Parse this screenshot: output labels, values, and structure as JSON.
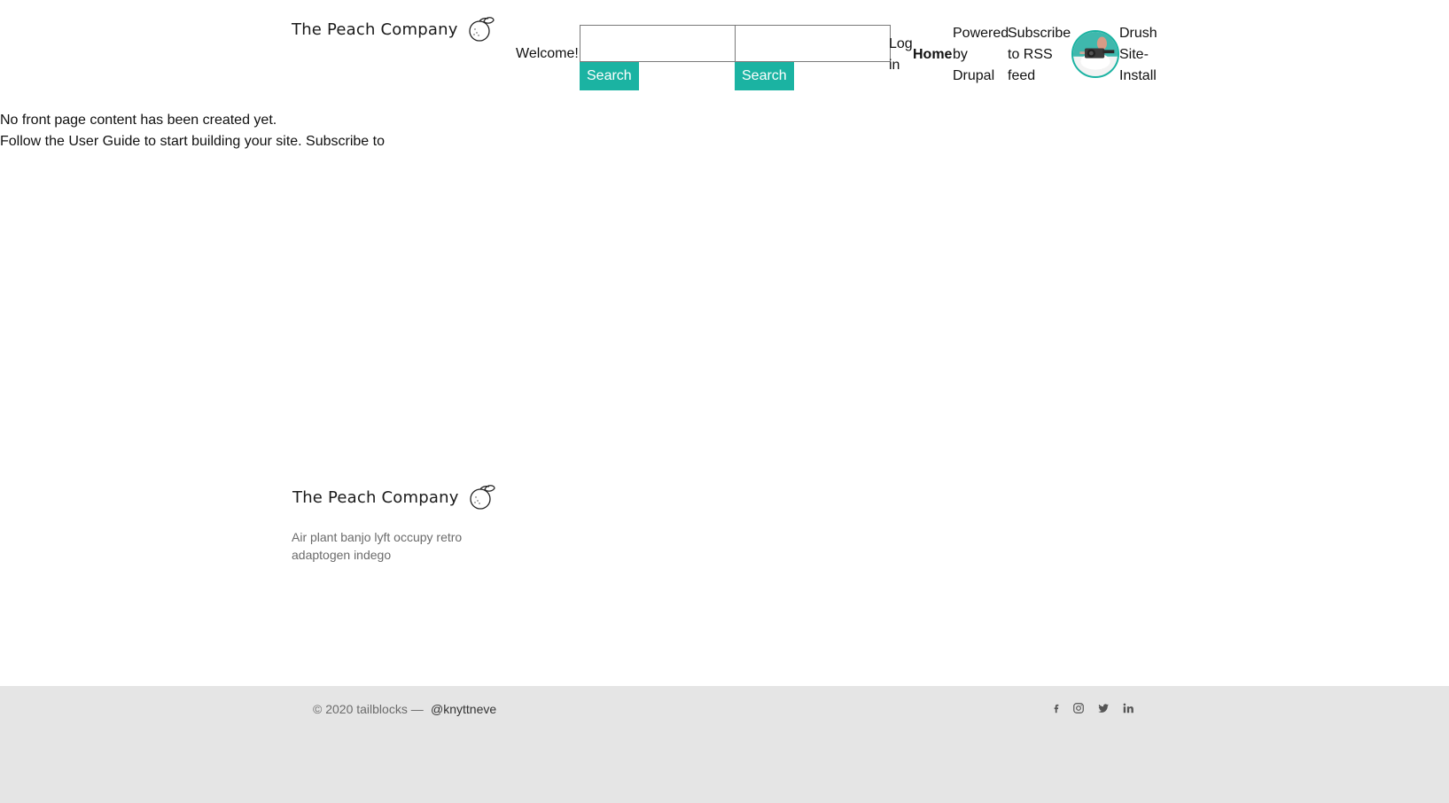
{
  "header": {
    "brand_name": "The Peach Company",
    "welcome": "Welcome!",
    "search_one": {
      "placeholder": "",
      "button_label": "Search"
    },
    "search_two": {
      "placeholder": "",
      "button_label": "Search"
    },
    "nav": {
      "login": "Log in",
      "home": "Home",
      "powered": "Powered by Drupal",
      "rss": "Subscribe to RSS feed",
      "drush": "Drush Site-Install"
    },
    "accent_color": "#1bb3a2"
  },
  "main": {
    "line_one": "No front page content has been created yet.",
    "line_two": "Follow the User Guide to start building your site. Subscribe to"
  },
  "footer": {
    "brand_name": "The Peach Company",
    "description": "Air plant banjo lyft occupy retro adaptogen indego",
    "copyright": "© 2020 tailblocks —",
    "handle": "@knyttneve",
    "social_icons": [
      "facebook-icon",
      "instagram-icon",
      "twitter-icon",
      "linkedin-icon"
    ],
    "background_color": "#e5e5e5"
  }
}
